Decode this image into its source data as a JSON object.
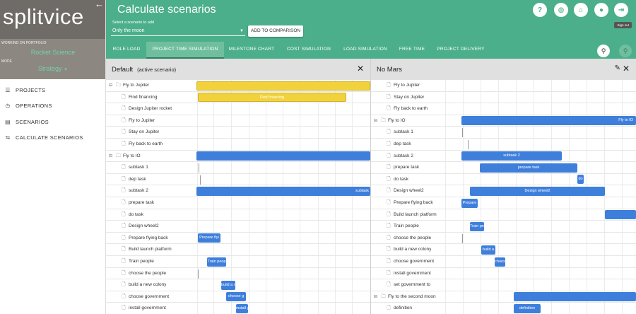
{
  "brand": {
    "logo": "splitvice"
  },
  "sidebar": {
    "working_label": "WORKING ON PORTFOLIO",
    "portfolio": "Rocket Science",
    "mode_label": "MODE",
    "mode": "Strategy",
    "items": [
      {
        "label": "PROJECTS",
        "icon": "list-icon"
      },
      {
        "label": "OPERATIONS",
        "icon": "clock-icon"
      },
      {
        "label": "SCENARIOS",
        "icon": "scenarios-icon"
      },
      {
        "label": "CALCULATE SCENARIOS",
        "icon": "calculate-icon"
      }
    ]
  },
  "header": {
    "title": "Calculate scenarios",
    "select_label": "Select a scenario to add",
    "select_value": "Only the moon",
    "add_button": "ADD TO COMPARISON",
    "tooltip": "Sign out",
    "tabs": [
      "ROLE LOAD",
      "PROJECT TIME SIMULATION",
      "MILESTONE CHART",
      "COST SIMULATION",
      "LOAD SIMULATION",
      "FREE TIME",
      "PROJECT DELIVERY"
    ],
    "active_tab": 1
  },
  "panels": [
    {
      "title": "Default",
      "subtitle": "(active scenario)",
      "rows": [
        {
          "label": "Fly to Jupiter",
          "group": true
        },
        {
          "label": "Find financing"
        },
        {
          "label": "Design Jupiter rocket"
        },
        {
          "label": "Fly to Jupiter"
        },
        {
          "label": "Stay on Jupiter"
        },
        {
          "label": "Fly back to earth"
        },
        {
          "label": "Fly to IO",
          "group": true
        },
        {
          "label": "subtask 1"
        },
        {
          "label": "dep task"
        },
        {
          "label": "subtask 2"
        },
        {
          "label": "prepare task"
        },
        {
          "label": "do task"
        },
        {
          "label": "Design wheel2"
        },
        {
          "label": "Prepare flying back"
        },
        {
          "label": "Build launch platform"
        },
        {
          "label": "Train people"
        },
        {
          "label": "choose the people"
        },
        {
          "label": "build a new colony"
        },
        {
          "label": "choose government"
        },
        {
          "label": "install government"
        }
      ],
      "bars": [
        {
          "row": 0,
          "label": ""
        },
        {
          "row": 1,
          "label": "Find financing"
        },
        {
          "row": 6,
          "label": ""
        },
        {
          "row": 9,
          "label": "subtask"
        },
        {
          "row": 13,
          "label": "Prepare flyi"
        },
        {
          "row": 15,
          "label": "Train peop"
        },
        {
          "row": 17,
          "label": "build a n"
        },
        {
          "row": 18,
          "label": "choose g"
        },
        {
          "row": 19,
          "label": "install g"
        }
      ]
    },
    {
      "title": "No Mars",
      "subtitle": "",
      "rows": [
        {
          "label": "Fly to Jupiter"
        },
        {
          "label": "Stay on Jupiter"
        },
        {
          "label": "Fly back to earth"
        },
        {
          "label": "Fly to IO",
          "group": true
        },
        {
          "label": "subtask 1"
        },
        {
          "label": "dep task"
        },
        {
          "label": "subtask 2"
        },
        {
          "label": "prepare task"
        },
        {
          "label": "do task"
        },
        {
          "label": "Design wheel2"
        },
        {
          "label": "Prepare flying back"
        },
        {
          "label": "Build launch platform"
        },
        {
          "label": "Train people"
        },
        {
          "label": "choose the people"
        },
        {
          "label": "build a new colony"
        },
        {
          "label": "choose government"
        },
        {
          "label": "install government"
        },
        {
          "label": "set government to"
        },
        {
          "label": "Fly to the second moon",
          "group": true
        },
        {
          "label": "definition"
        }
      ],
      "bars": [
        {
          "row": 3,
          "label": "Fly to IO"
        },
        {
          "row": 6,
          "label": "subtask 2"
        },
        {
          "row": 7,
          "label": "prepare task"
        },
        {
          "row": 8,
          "label": "do"
        },
        {
          "row": 9,
          "label": "Design wheel2"
        },
        {
          "row": 10,
          "label": "Prepare"
        },
        {
          "row": 11,
          "label": ""
        },
        {
          "row": 12,
          "label": "Train pe"
        },
        {
          "row": 14,
          "label": "build a"
        },
        {
          "row": 15,
          "label": "choos"
        },
        {
          "row": 18,
          "label": ""
        },
        {
          "row": 19,
          "label": "definition"
        }
      ]
    }
  ],
  "colors": {
    "header": "#4caf8c",
    "bar_blue": "#3f7fdc",
    "bar_yellow": "#f2d23c"
  }
}
